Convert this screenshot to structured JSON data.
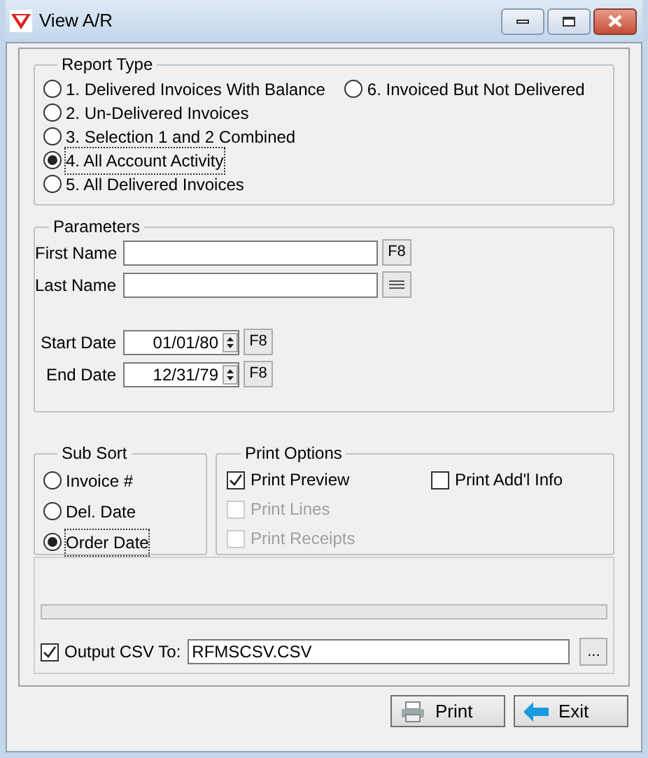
{
  "window": {
    "title": "View A/R"
  },
  "report_type": {
    "title": "Report Type",
    "columns": [
      [
        {
          "label": "1. Delivered Invoices With Balance",
          "selected": false
        },
        {
          "label": "2. Un-Delivered Invoices",
          "selected": false
        },
        {
          "label": "3. Selection 1 and 2 Combined",
          "selected": false
        },
        {
          "label": "4. All Account Activity",
          "selected": true
        },
        {
          "label": "5. All Delivered Invoices",
          "selected": false
        }
      ],
      [
        {
          "label": "6. Invoiced But Not Delivered",
          "selected": false
        }
      ]
    ]
  },
  "parameters": {
    "title": "Parameters",
    "names": [
      {
        "label": "First Name",
        "button": {
          "kind": "text",
          "label": "F8"
        }
      },
      {
        "label": "Last Name",
        "button": {
          "kind": "list"
        }
      }
    ],
    "dates": [
      {
        "label": "Start Date",
        "value": "01/01/80",
        "button": "F8"
      },
      {
        "label": "End Date",
        "value": "12/31/79",
        "button": "F8"
      }
    ]
  },
  "sub_sort": {
    "title": "Sub Sort",
    "options": [
      {
        "label": "Invoice #",
        "selected": false
      },
      {
        "label": "Del. Date",
        "selected": false
      },
      {
        "label": "Order Date",
        "selected": true
      }
    ]
  },
  "print_options": {
    "title": "Print Options",
    "columns": [
      [
        {
          "label": "Print Preview",
          "checked": true,
          "disabled": false
        },
        {
          "label": "Print Lines",
          "checked": false,
          "disabled": true
        },
        {
          "label": "Print Receipts",
          "checked": false,
          "disabled": true
        }
      ],
      [
        {
          "label": "Print Add'l Info",
          "checked": false,
          "disabled": false
        }
      ]
    ]
  },
  "csv": {
    "label": "Output CSV To:",
    "checked": true,
    "value": "RFMSCSV.CSV",
    "browse": "..."
  },
  "buttons": [
    {
      "kind": "print",
      "label": "Print"
    },
    {
      "kind": "exit",
      "label": "Exit"
    }
  ]
}
